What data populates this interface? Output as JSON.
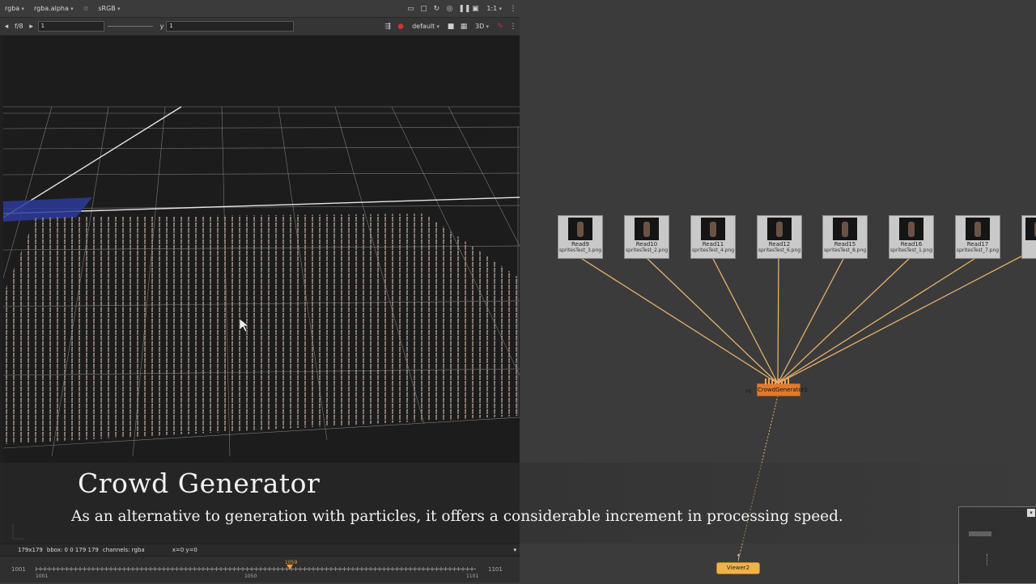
{
  "viewer": {
    "channel": "rgba",
    "alpha": "rgba.alpha",
    "colorspace": "sRGB",
    "zoom": "1:1",
    "fstop": "f/8",
    "frame_value": "1",
    "y_label": "y",
    "y_value": "1",
    "view_mode": "default",
    "view_3d": "3D"
  },
  "status": {
    "size": "179x179",
    "bbox": "bbox: 0 0 179 179",
    "channels": "channels: rgba",
    "coords": "x=0 y=0"
  },
  "timeline": {
    "start_left": "1001",
    "start": "1001",
    "mid": "1050",
    "current": "1059",
    "end": "1101",
    "end_right": "1101"
  },
  "nodes": [
    {
      "name": "Read9",
      "file": "spritesTest_3.png"
    },
    {
      "name": "Read10",
      "file": "spritesTest_2.png"
    },
    {
      "name": "Read11",
      "file": "spritesTest_4.png"
    },
    {
      "name": "Read12",
      "file": "spritesTest_6.png"
    },
    {
      "name": "Read15",
      "file": "spritesTest_8.png"
    },
    {
      "name": "Read16",
      "file": "spritesTest_1.png"
    },
    {
      "name": "Read17",
      "file": "spritesTest_7.png"
    }
  ],
  "crowd_node": "CrowdGenerator1",
  "crowd_node_prefix": "P8",
  "viewer_node": "Viewer2",
  "caption": {
    "title": "Crowd Generator",
    "text": "As an alternative to generation with particles, it offers a considerable increment in processing speed."
  },
  "colors": {
    "wire": "#e8b06a",
    "crowd_node": "#e07a2e",
    "viewer_node": "#f0b24a"
  }
}
